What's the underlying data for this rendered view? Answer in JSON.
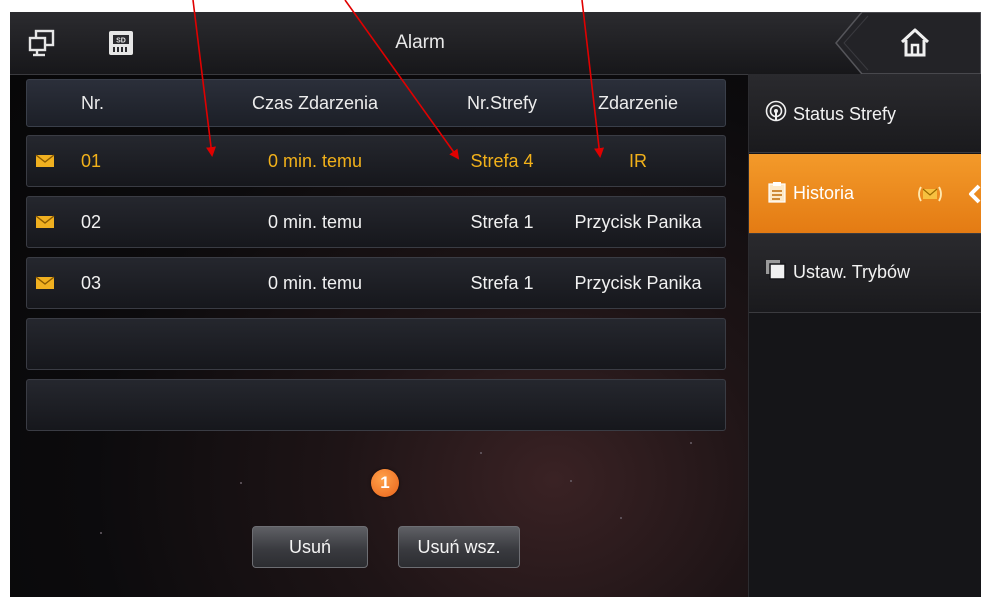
{
  "header": {
    "title": "Alarm"
  },
  "table": {
    "columns": [
      "Nr.",
      "Czas Zdarzenia",
      "Nr.Strefy",
      "Zdarzenie"
    ],
    "rows": [
      {
        "nr": "01",
        "time": "0 min. temu",
        "zone": "Strefa 4",
        "event": "IR",
        "highlighted": true
      },
      {
        "nr": "02",
        "time": "0 min. temu",
        "zone": "Strefa 1",
        "event": "Przycisk Panika",
        "highlighted": false
      },
      {
        "nr": "03",
        "time": "0 min. temu",
        "zone": "Strefa 1",
        "event": "Przycisk Panika",
        "highlighted": false
      }
    ]
  },
  "pagination": {
    "current_page": "1"
  },
  "buttons": {
    "delete": "Usuń",
    "delete_all": "Usuń wsz."
  },
  "sidebar": {
    "items": [
      {
        "label": "Status Strefy",
        "icon": "signal-icon",
        "active": false
      },
      {
        "label": "Historia",
        "icon": "clipboard-icon",
        "active": true
      },
      {
        "label": "Ustaw. Trybów",
        "icon": "copy-icon",
        "active": false
      }
    ]
  },
  "icons": {
    "top_left": "monitor-icon",
    "top_sd": "sd-card-icon",
    "home": "home-icon",
    "row_message": "envelope-icon"
  },
  "colors": {
    "accent": "#e8821a",
    "highlight_text": "#f2b11a",
    "annotation_arrow": "#e00000"
  }
}
